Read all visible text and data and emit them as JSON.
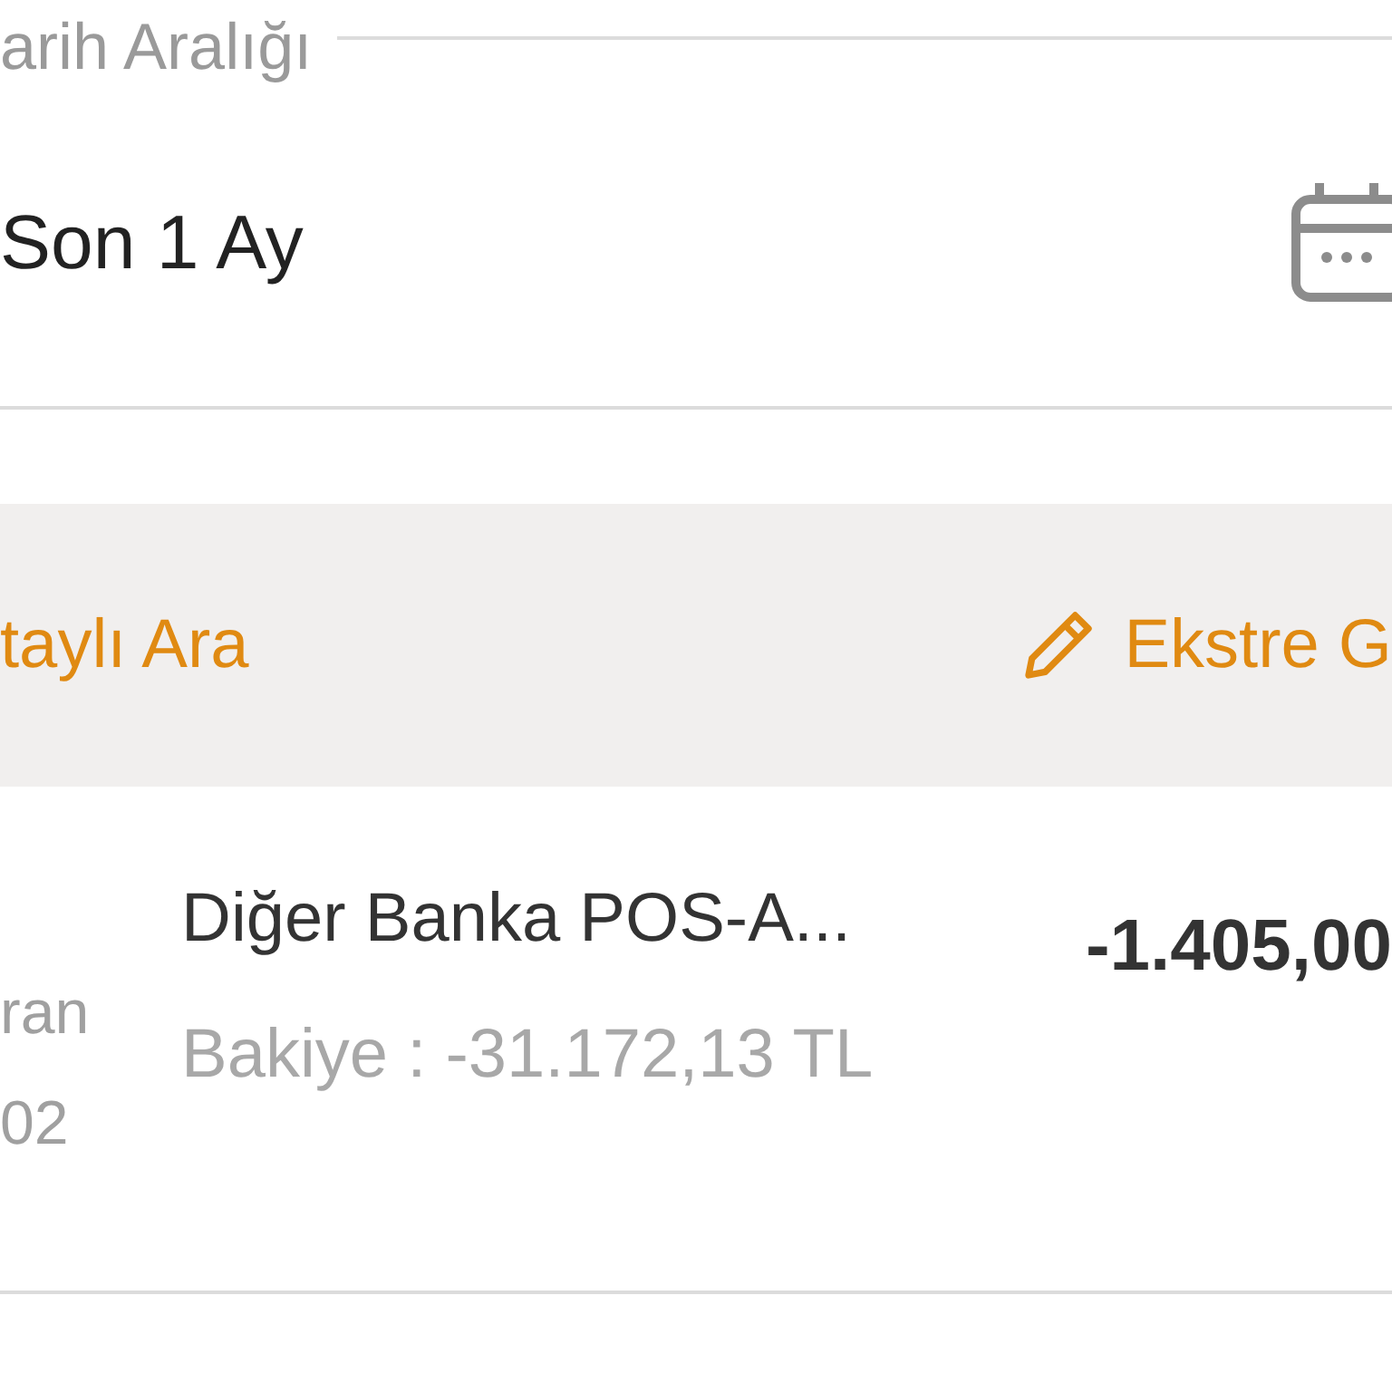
{
  "date_range": {
    "legend": "arih Aralığı",
    "value": "Son 1 Ay"
  },
  "action_bar": {
    "left_link": "taylı Ara",
    "right_link": "Ekstre G"
  },
  "transactions": [
    {
      "date_line_1": "ran",
      "date_line_2": "02",
      "description": "Diğer Banka POS-A...",
      "balance": "Bakiye : -31.172,13 TL",
      "amount": "-1.405,00"
    }
  ]
}
